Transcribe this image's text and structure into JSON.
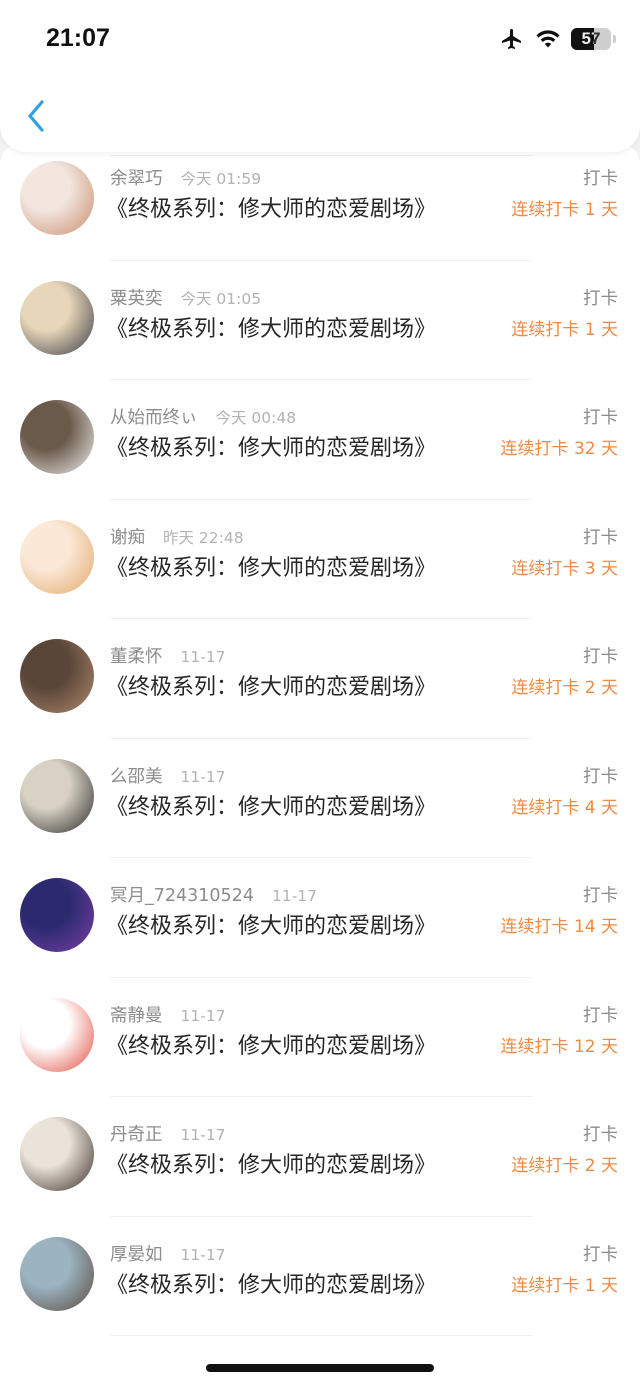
{
  "status_bar": {
    "time": "21:07",
    "battery": "57",
    "battery_level": 0.57
  },
  "nav": {
    "back_icon": "chevron-left-icon",
    "accent": "#2e9fe6"
  },
  "colors": {
    "streak": "#f08a42"
  },
  "checkins": [
    {
      "username": "",
      "time": "",
      "title": "《终极系列：修大师的恋爱剧场》",
      "action": "打卡",
      "streak": "连续打卡 2 天",
      "avatar": [
        "#8ab0c8",
        "#d9c1a4"
      ]
    },
    {
      "username": "余翠巧",
      "time": "今天 01:59",
      "title": "《终极系列：修大师的恋爱剧场》",
      "action": "打卡",
      "streak": "连续打卡 1 天",
      "avatar": [
        "#f2e6df",
        "#c98a6a"
      ]
    },
    {
      "username": "粟英奕",
      "time": "今天 01:05",
      "title": "《终极系列：修大师的恋爱剧场》",
      "action": "打卡",
      "streak": "连续打卡 1 天",
      "avatar": [
        "#e7d6b9",
        "#3a3a44"
      ]
    },
    {
      "username": "从始而终ぃ",
      "time": "今天 00:48",
      "title": "《终极系列：修大师的恋爱剧场》",
      "action": "打卡",
      "streak": "连续打卡 32 天",
      "avatar": [
        "#6a5a4a",
        "#f2f2f2"
      ]
    },
    {
      "username": "谢痴",
      "time": "昨天 22:48",
      "title": "《终极系列：修大师的恋爱剧场》",
      "action": "打卡",
      "streak": "连续打卡 3 天",
      "avatar": [
        "#fbe8d6",
        "#e2a86a"
      ]
    },
    {
      "username": "董柔怀",
      "time": "11-17",
      "title": "《终极系列：修大师的恋爱剧场》",
      "action": "打卡",
      "streak": "连续打卡 2 天",
      "avatar": [
        "#5a4638",
        "#b08a6e"
      ]
    },
    {
      "username": "么邵美",
      "time": "11-17",
      "title": "《终极系列：修大师的恋爱剧场》",
      "action": "打卡",
      "streak": "连续打卡 4 天",
      "avatar": [
        "#d8d2c4",
        "#2a2a2a"
      ]
    },
    {
      "username": "冥月_724310524",
      "time": "11-17",
      "title": "《终极系列：修大师的恋爱剧场》",
      "action": "打卡",
      "streak": "连续打卡 14 天",
      "avatar": [
        "#2b2a6e",
        "#7a3fa8"
      ]
    },
    {
      "username": "斋静曼",
      "time": "11-17",
      "title": "《终极系列：修大师的恋爱剧场》",
      "action": "打卡",
      "streak": "连续打卡 12 天",
      "avatar": [
        "#ffffff",
        "#e14a3c"
      ]
    },
    {
      "username": "丹奇正",
      "time": "11-17",
      "title": "《终极系列：修大师的恋爱剧场》",
      "action": "打卡",
      "streak": "连续打卡 2 天",
      "avatar": [
        "#e9e3da",
        "#3a2c26"
      ]
    },
    {
      "username": "厚晏如",
      "time": "11-17",
      "title": "《终极系列：修大师的恋爱剧场》",
      "action": "打卡",
      "streak": "连续打卡 1 天",
      "avatar": [
        "#9cb4c2",
        "#5a4a3c"
      ]
    }
  ]
}
